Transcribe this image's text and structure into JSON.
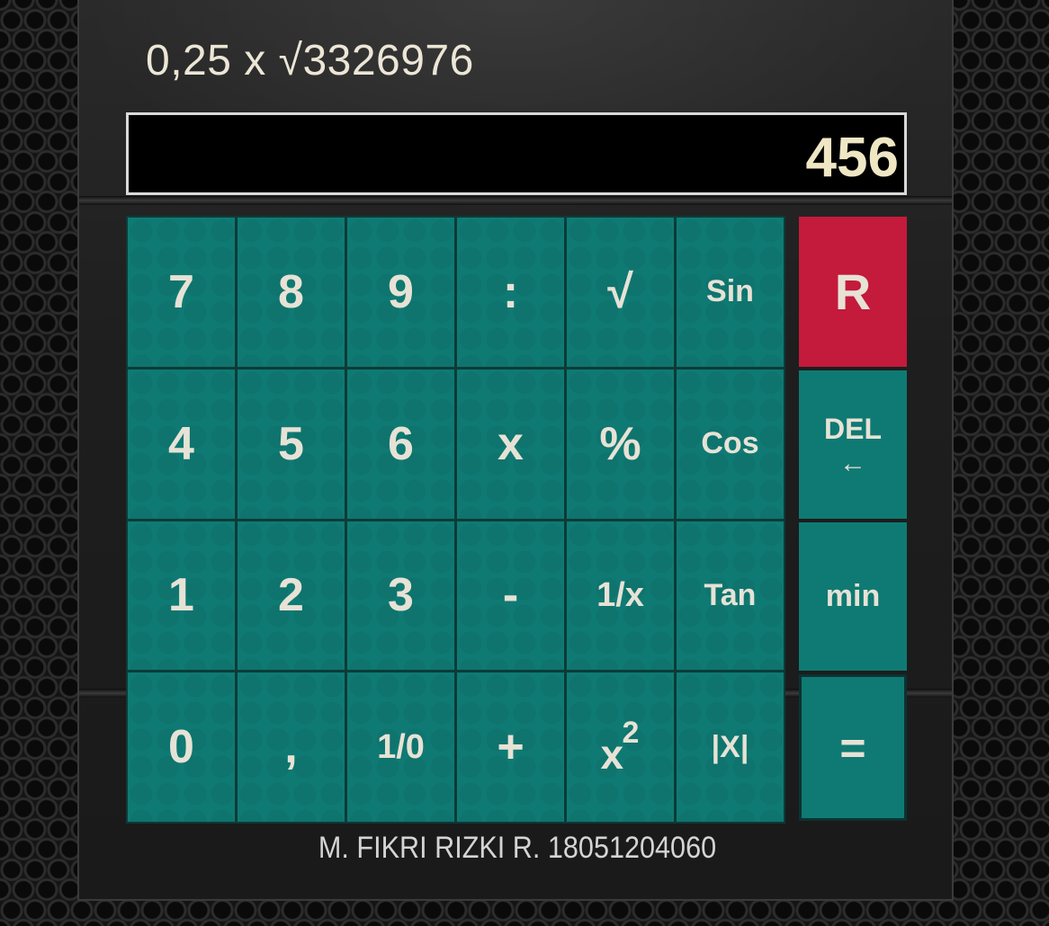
{
  "expression": "0,25 x √3326976",
  "display_value": "456",
  "keypad": [
    [
      "7",
      "8",
      "9",
      ":",
      "√",
      "Sin"
    ],
    [
      "4",
      "5",
      "6",
      "x",
      "%",
      "Cos"
    ],
    [
      "1",
      "2",
      "3",
      "-",
      "1/x",
      "Tan"
    ],
    [
      "0",
      ",",
      "1/0",
      "+",
      "x²",
      "|X|"
    ]
  ],
  "square_key": {
    "base": "x",
    "exponent": "2"
  },
  "side_keys": {
    "reset": "R",
    "delete": "DEL",
    "delete_arrow": "←",
    "min": "min",
    "equals": "="
  },
  "credit": "M. FIKRI RIZKI R. 18051204060",
  "colors": {
    "key": "#0f7a73",
    "reset": "#c41a3b",
    "display_text": "#efe6c4"
  }
}
